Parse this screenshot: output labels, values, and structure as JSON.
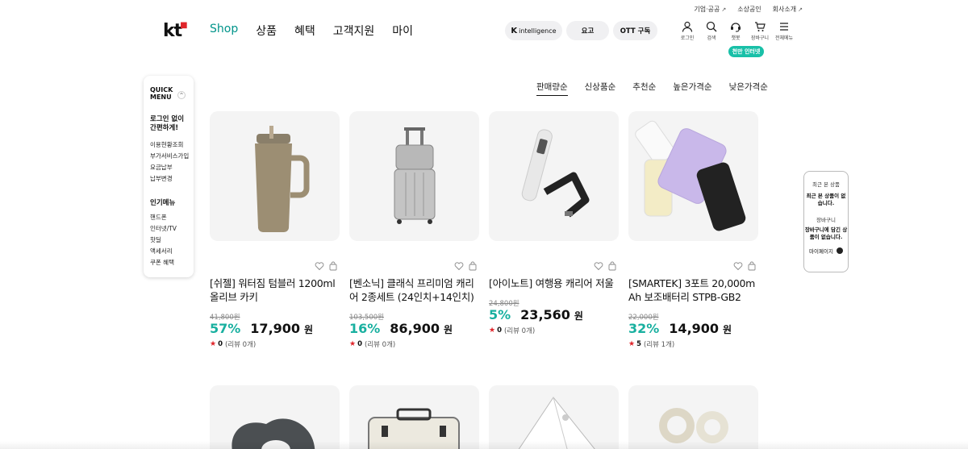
{
  "util_links": [
    {
      "label": "기업·공공",
      "ext": true
    },
    {
      "label": "소상공인",
      "ext": false
    },
    {
      "label": "회사소개",
      "ext": true
    }
  ],
  "logo": "kt",
  "gnb": [
    {
      "label": "Shop",
      "active": true
    },
    {
      "label": "상품",
      "active": false
    },
    {
      "label": "혜택",
      "active": false
    },
    {
      "label": "고객지원",
      "active": false
    },
    {
      "label": "마이",
      "active": false
    }
  ],
  "pills": {
    "k_brand": "K",
    "k_text": "intelligence",
    "yogo": "요고",
    "ott": "OTT 구독"
  },
  "header_icons": [
    {
      "name": "login-icon",
      "label": "로그인"
    },
    {
      "name": "search-icon",
      "label": "검색"
    },
    {
      "name": "chatbot-icon",
      "label": "챗봇"
    },
    {
      "name": "cart-icon",
      "label": "장바구니"
    },
    {
      "name": "menu-icon",
      "label": "전체메뉴"
    }
  ],
  "net_badge": "천만 인터넷",
  "quick_menu": {
    "title_line1": "QUICK",
    "title_line2": "MENU",
    "login_prompt_1": "로그인 없이",
    "login_prompt_2": "간편하게!",
    "links": [
      "이용현황조회",
      "부가서비스가입",
      "요금납부",
      "납부변경"
    ],
    "popular_title": "인기메뉴",
    "popular": [
      "핸드폰",
      "인터넷/TV",
      "핫딜",
      "액세서리",
      "쿠폰 혜택"
    ]
  },
  "sort_options": [
    {
      "label": "판매량순",
      "active": true
    },
    {
      "label": "신상품순",
      "active": false
    },
    {
      "label": "추천순",
      "active": false
    },
    {
      "label": "높은가격순",
      "active": false
    },
    {
      "label": "낮은가격순",
      "active": false
    }
  ],
  "products": [
    {
      "name": "[쉬젤] 워터짐 텀블러 1200ml 올리브 카키",
      "orig": "41,800원",
      "disc": "57%",
      "price": "17,900",
      "won": "원",
      "rating": "0",
      "reviews": "(리뷰 0개)"
    },
    {
      "name": "[벤소닉] 클래식 프리미엄 캐리어 2종세트 (24인치+14인치)",
      "orig": "103,500원",
      "disc": "16%",
      "price": "86,900",
      "won": "원",
      "rating": "0",
      "reviews": "(리뷰 0개)"
    },
    {
      "name": "[아이노트] 여행용 캐리어 저울",
      "orig": "24,800원",
      "disc": "5%",
      "price": "23,560",
      "won": "원",
      "rating": "0",
      "reviews": "(리뷰 0개)"
    },
    {
      "name": "[SMARTEK] 3포트 20,000mAh 보조배터리 STPB-GB2",
      "orig": "22,000원",
      "disc": "32%",
      "price": "14,900",
      "won": "원",
      "rating": "5",
      "reviews": "(리뷰 1개)"
    }
  ],
  "recent": {
    "title": "최근 본 상품",
    "empty": "최근 본 상품이 없습니다.",
    "cart_title": "장바구니",
    "cart_empty": "장바구니에 담긴 상품이 없습니다.",
    "mypage": "마이페이지"
  },
  "colors": {
    "accent": "#00948a",
    "discount": "#19b0a0",
    "badge": "#19c0a8",
    "star": "#e0242a"
  }
}
